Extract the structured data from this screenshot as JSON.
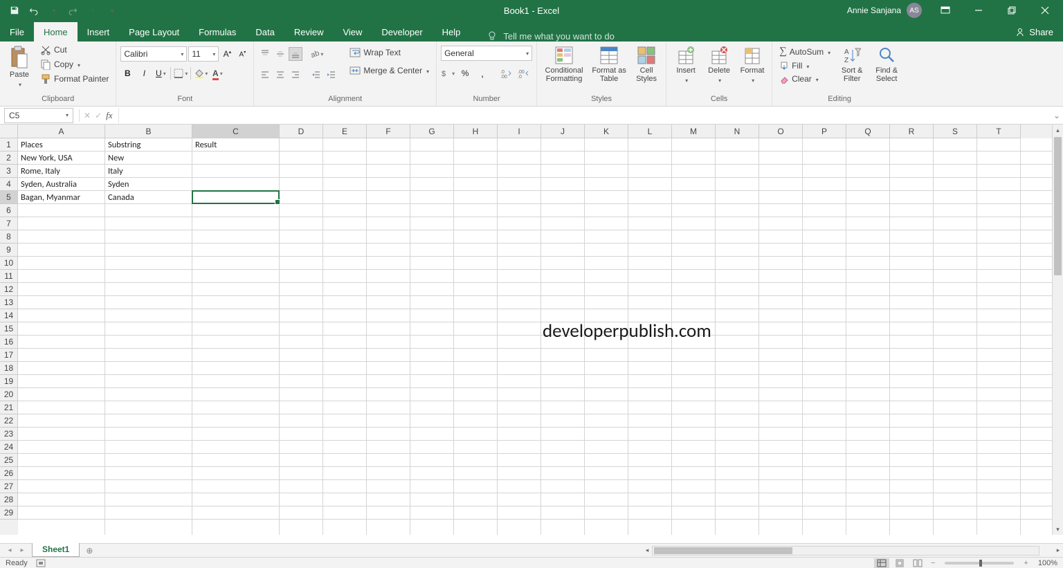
{
  "title": "Book1  -  Excel",
  "user": {
    "name": "Annie Sanjana",
    "initials": "AS"
  },
  "qat": {
    "save": "Save",
    "undo": "Undo",
    "redo": "Redo"
  },
  "tabs": [
    "File",
    "Home",
    "Insert",
    "Page Layout",
    "Formulas",
    "Data",
    "Review",
    "View",
    "Developer",
    "Help"
  ],
  "active_tab": "Home",
  "tell_me": "Tell me what you want to do",
  "share": "Share",
  "ribbon": {
    "clipboard": {
      "label": "Clipboard",
      "paste": "Paste",
      "cut": "Cut",
      "copy": "Copy",
      "format_painter": "Format Painter"
    },
    "font": {
      "label": "Font",
      "name": "Calibri",
      "size": "11"
    },
    "alignment": {
      "label": "Alignment",
      "wrap": "Wrap Text",
      "merge": "Merge & Center"
    },
    "number": {
      "label": "Number",
      "format": "General"
    },
    "styles": {
      "label": "Styles",
      "cond": "Conditional Formatting",
      "table": "Format as Table",
      "cell": "Cell Styles"
    },
    "cells": {
      "label": "Cells",
      "insert": "Insert",
      "delete": "Delete",
      "format": "Format"
    },
    "editing": {
      "label": "Editing",
      "autosum": "AutoSum",
      "fill": "Fill",
      "clear": "Clear",
      "sort": "Sort & Filter",
      "find": "Find & Select"
    }
  },
  "name_box": "C5",
  "formula": "",
  "columns": [
    "A",
    "B",
    "C",
    "D",
    "E",
    "F",
    "G",
    "H",
    "I",
    "J",
    "K",
    "L",
    "M",
    "N",
    "O",
    "P",
    "Q",
    "R",
    "S",
    "T"
  ],
  "col_widths": {
    "A": 126,
    "B": 126,
    "C": 126,
    "default": 63
  },
  "selected_col": "C",
  "selected_row": 5,
  "row_count": 29,
  "cells": {
    "A1": "Places",
    "B1": "Substring",
    "C1": "Result",
    "A2": "New York, USA",
    "B2": "New",
    "A3": "Rome, Italy",
    "B3": "Italy",
    "A4": "Syden, Australia",
    "B4": "Syden",
    "A5": "Bagan, Myanmar",
    "B5": "Canada"
  },
  "watermark": "developerpublish.com",
  "sheets": [
    "Sheet1"
  ],
  "active_sheet": "Sheet1",
  "status": {
    "ready": "Ready",
    "zoom": "100%"
  }
}
